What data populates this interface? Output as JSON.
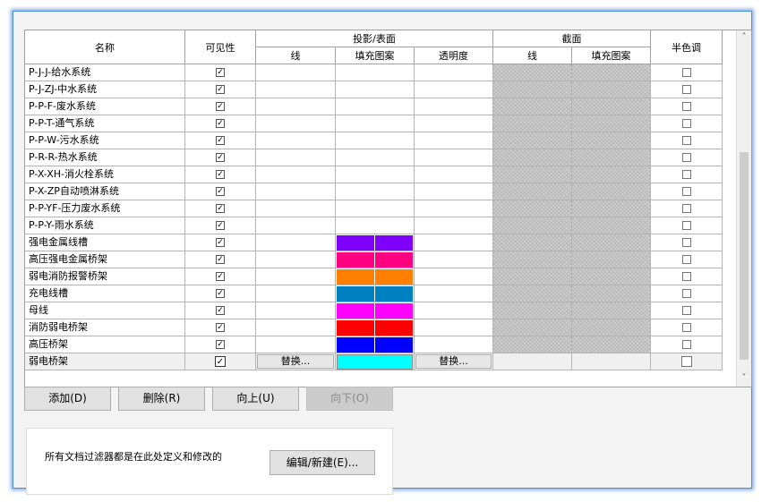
{
  "headers": {
    "name": "名称",
    "visible": "可见性",
    "projection_group": "投影/表面",
    "cut_group": "截面",
    "halftone": "半色调",
    "proj_line": "线",
    "proj_fill": "填充图案",
    "proj_transparency": "透明度",
    "cut_line": "线",
    "cut_fill": "填充图案"
  },
  "rows": [
    {
      "name": "P-J-J-给水系统",
      "visible": true,
      "fill": ""
    },
    {
      "name": "P-J-ZJ-中水系统",
      "visible": true,
      "fill": ""
    },
    {
      "name": "P-P-F-废水系统",
      "visible": true,
      "fill": ""
    },
    {
      "name": "P-P-T-通气系统",
      "visible": true,
      "fill": ""
    },
    {
      "name": "P-P-W-污水系统",
      "visible": true,
      "fill": ""
    },
    {
      "name": "P-R-R-热水系统",
      "visible": true,
      "fill": ""
    },
    {
      "name": "P-X-XH-消火栓系统",
      "visible": true,
      "fill": ""
    },
    {
      "name": "P-X-ZP自动喷淋系统",
      "visible": true,
      "fill": ""
    },
    {
      "name": "P-P-YF-压力废水系统",
      "visible": true,
      "fill": ""
    },
    {
      "name": "P-P-Y-雨水系统",
      "visible": true,
      "fill": ""
    },
    {
      "name": "强电金属线槽",
      "visible": true,
      "fill": "#8000ff"
    },
    {
      "name": "高压强电金属桥架",
      "visible": true,
      "fill": "#ff0080"
    },
    {
      "name": "弱电消防报警桥架",
      "visible": true,
      "fill": "#ff8000"
    },
    {
      "name": "充电线槽",
      "visible": true,
      "fill": "#0080c0"
    },
    {
      "name": "母线",
      "visible": true,
      "fill": "#ff00ff"
    },
    {
      "name": "消防弱电桥架",
      "visible": true,
      "fill": "#ff0000"
    },
    {
      "name": "高压桥架",
      "visible": true,
      "fill": "#0000ff"
    },
    {
      "name": "弱电桥架",
      "visible": true,
      "fill": "#00ffff",
      "selected": true
    }
  ],
  "override_label": "替换...",
  "buttons": {
    "add": "添加(D)",
    "delete": "删除(R)",
    "up": "向上(U)",
    "down": "向下(O)"
  },
  "panel": {
    "text": "所有文档过滤器都是在此处定义和修改的",
    "edit_button": "编辑/新建(E)..."
  },
  "colors": {
    "frame_border": "#4a90d9",
    "hatch": "#cfcfcf"
  }
}
